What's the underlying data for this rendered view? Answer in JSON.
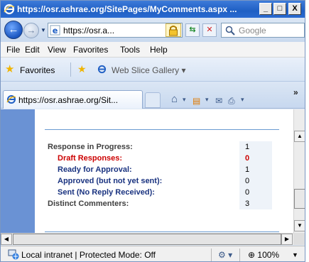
{
  "window": {
    "title": "https://osr.ashrae.org/SitePages/MyComments.aspx ...",
    "controls": {
      "minimize": "_",
      "maximize": "□",
      "close": "X"
    }
  },
  "address_bar": {
    "url": "https://osr.a...",
    "search_placeholder": "Google"
  },
  "menu": [
    "File",
    "Edit",
    "View",
    "Favorites",
    "Tools",
    "Help"
  ],
  "favorites_bar": {
    "favorites_label": "Favorites",
    "web_slice_label": "Web Slice Gallery"
  },
  "tab": {
    "title": "https://osr.ashrae.org/Sit..."
  },
  "stats": {
    "rows": [
      {
        "label": "Response in Progress:",
        "value": "1"
      },
      {
        "label": "Draft Responses:",
        "value": "0"
      },
      {
        "label": "Ready for Approval:",
        "value": "1"
      },
      {
        "label": "Approved (but not yet sent):",
        "value": "0"
      },
      {
        "label": "Sent (No Reply Received):",
        "value": "0"
      },
      {
        "label": "Distinct Commenters:",
        "value": "3"
      }
    ]
  },
  "status_bar": {
    "zone_text": "Local intranet | Protected Mode: Off",
    "zoom": "100%"
  },
  "colors": {
    "title_bar": "#1f5fc4",
    "left_band": "#6a92d4",
    "draft_red": "#cc0000",
    "label_blue": "#1a3380"
  }
}
